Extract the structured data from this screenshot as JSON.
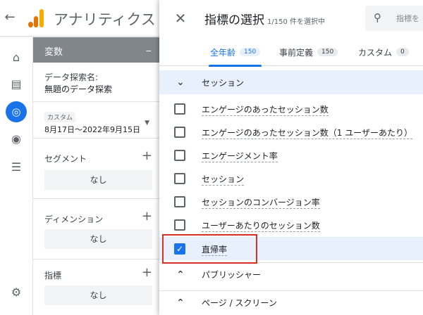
{
  "app": {
    "title": "アナリティクス"
  },
  "variables": {
    "header": "変数",
    "minimize": "_",
    "exploration_name_label": "データ探索名:",
    "exploration_name": "無題のデータ探索",
    "date_chip": "カスタム",
    "date_range": "8月17日～2022年9月15日",
    "segment_label": "セグメント",
    "dimension_label": "ディメンション",
    "metric_label": "指標",
    "none": "なし",
    "plus": "+"
  },
  "dialog": {
    "title": "指標の選択",
    "selected_count": "1/150 件を選択中",
    "search_placeholder": "指標を",
    "close": "✕",
    "tabs": [
      {
        "label": "全年齢",
        "count": "150"
      },
      {
        "label": "事前定義",
        "count": "150"
      },
      {
        "label": "カスタム",
        "count": "0"
      }
    ],
    "groups": [
      {
        "label": "セッション",
        "chevron": "⌄"
      },
      {
        "label": "パブリッシャー",
        "chevron": "⌃"
      },
      {
        "label": "ページ / スクリーン",
        "chevron": "⌃"
      }
    ],
    "items": [
      {
        "label": "エンゲージのあったセッション数",
        "checked": false
      },
      {
        "label": "エンゲージのあったセッション数（1 ユーザーあたり）",
        "checked": false
      },
      {
        "label": "エンゲージメント率",
        "checked": false
      },
      {
        "label": "セッション",
        "checked": false
      },
      {
        "label": "セッションのコンバージョン率",
        "checked": false
      },
      {
        "label": "ユーザーあたりのセッション数",
        "checked": false
      },
      {
        "label": "直帰率",
        "checked": true
      }
    ]
  },
  "colors": {
    "accent": "#1a73e8",
    "highlight": "#d93025",
    "brand": "#f9ab00"
  },
  "icons": [
    "back-arrow-icon",
    "analytics-logo-icon",
    "home-icon",
    "reports-icon",
    "explore-icon",
    "advertising-icon",
    "configure-icon",
    "settings-icon",
    "close-icon",
    "search-icon",
    "chevron-down-icon",
    "chevron-up-icon",
    "checkbox-icon"
  ]
}
